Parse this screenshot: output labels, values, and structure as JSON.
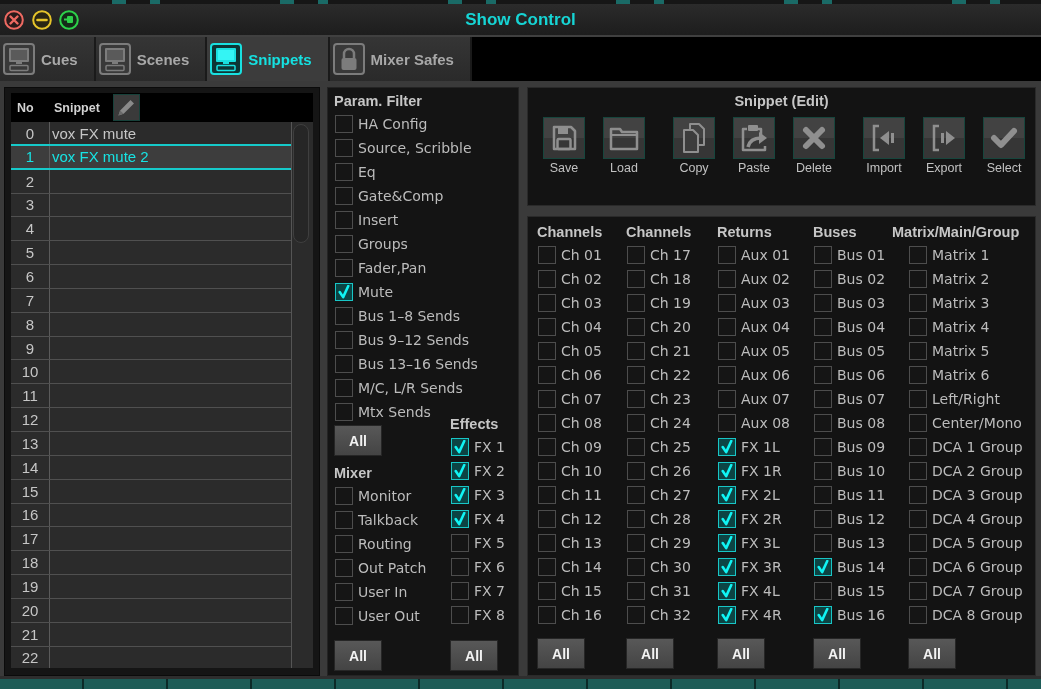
{
  "window": {
    "title": "Show Control"
  },
  "tabs": [
    {
      "label": "Cues",
      "kind": "monitor",
      "selected": false
    },
    {
      "label": "Scenes",
      "kind": "monitor",
      "selected": false
    },
    {
      "label": "Snippets",
      "kind": "monitor",
      "selected": true
    },
    {
      "label": "Mixer Safes",
      "kind": "lock",
      "selected": false
    }
  ],
  "snippet_list": {
    "columns": [
      "No",
      "Snippet"
    ],
    "rows": [
      {
        "no": "0",
        "name": "vox FX mute",
        "selected": false
      },
      {
        "no": "1",
        "name": "vox FX mute 2",
        "selected": true
      },
      {
        "no": "2",
        "selected": false
      },
      {
        "no": "3",
        "selected": false
      },
      {
        "no": "4",
        "selected": false
      },
      {
        "no": "5",
        "selected": false
      },
      {
        "no": "6",
        "selected": false
      },
      {
        "no": "7",
        "selected": false
      },
      {
        "no": "8",
        "selected": false
      },
      {
        "no": "9",
        "selected": false
      },
      {
        "no": "10",
        "selected": false
      },
      {
        "no": "11",
        "selected": false
      },
      {
        "no": "12",
        "selected": false
      },
      {
        "no": "13",
        "selected": false
      },
      {
        "no": "14",
        "selected": false
      },
      {
        "no": "15",
        "selected": false
      },
      {
        "no": "16",
        "selected": false
      },
      {
        "no": "17",
        "selected": false
      },
      {
        "no": "18",
        "selected": false
      },
      {
        "no": "19",
        "selected": false
      },
      {
        "no": "20",
        "selected": false
      },
      {
        "no": "21",
        "selected": false
      },
      {
        "no": "22",
        "selected": false
      }
    ]
  },
  "param_filter": {
    "title": "Param. Filter",
    "items": [
      {
        "label": "HA Config",
        "checked": false
      },
      {
        "label": "Source, Scribble",
        "checked": false
      },
      {
        "label": "Eq",
        "checked": false
      },
      {
        "label": "Gate&Comp",
        "checked": false
      },
      {
        "label": "Insert",
        "checked": false
      },
      {
        "label": "Groups",
        "checked": false
      },
      {
        "label": "Fader,Pan",
        "checked": false
      },
      {
        "label": "Mute",
        "checked": true
      },
      {
        "label": "Bus 1–8 Sends",
        "checked": false
      },
      {
        "label": "Bus 9–12 Sends",
        "checked": false
      },
      {
        "label": "Bus 13–16 Sends",
        "checked": false
      },
      {
        "label": "M/C, L/R Sends",
        "checked": false
      },
      {
        "label": "Mtx Sends",
        "checked": false
      }
    ],
    "all_button": "All"
  },
  "mixer": {
    "title": "Mixer",
    "items": [
      {
        "label": "Monitor",
        "checked": false
      },
      {
        "label": "Talkback",
        "checked": false
      },
      {
        "label": "Routing",
        "checked": false
      },
      {
        "label": "Out Patch",
        "checked": false
      },
      {
        "label": "User In",
        "checked": false
      },
      {
        "label": "User Out",
        "checked": false
      }
    ],
    "all_button": "All"
  },
  "effects": {
    "title": "Effects",
    "items": [
      {
        "label": "FX 1",
        "checked": true
      },
      {
        "label": "FX 2",
        "checked": true
      },
      {
        "label": "FX 3",
        "checked": true
      },
      {
        "label": "FX 4",
        "checked": true
      },
      {
        "label": "FX 5",
        "checked": false
      },
      {
        "label": "FX 6",
        "checked": false
      },
      {
        "label": "FX 7",
        "checked": false
      },
      {
        "label": "FX 8",
        "checked": false
      }
    ],
    "all_button": "All"
  },
  "snippet_edit": {
    "title": "Snippet (Edit)",
    "groups": [
      {
        "buttons": [
          {
            "label": "Save",
            "kind": "save"
          },
          {
            "label": "Load",
            "kind": "load"
          }
        ]
      },
      {
        "buttons": [
          {
            "label": "Copy",
            "kind": "copy"
          },
          {
            "label": "Paste",
            "kind": "paste"
          },
          {
            "label": "Delete",
            "kind": "delete"
          }
        ]
      },
      {
        "buttons": [
          {
            "label": "Import",
            "kind": "import"
          },
          {
            "label": "Export",
            "kind": "export"
          },
          {
            "label": "Select",
            "kind": "select"
          }
        ]
      }
    ]
  },
  "sections": [
    {
      "title": "Channels",
      "items": [
        {
          "label": "Ch 01",
          "checked": false
        },
        {
          "label": "Ch 02",
          "checked": false
        },
        {
          "label": "Ch 03",
          "checked": false
        },
        {
          "label": "Ch 04",
          "checked": false
        },
        {
          "label": "Ch 05",
          "checked": false
        },
        {
          "label": "Ch 06",
          "checked": false
        },
        {
          "label": "Ch 07",
          "checked": false
        },
        {
          "label": "Ch 08",
          "checked": false
        },
        {
          "label": "Ch 09",
          "checked": false
        },
        {
          "label": "Ch 10",
          "checked": false
        },
        {
          "label": "Ch 11",
          "checked": false
        },
        {
          "label": "Ch 12",
          "checked": false
        },
        {
          "label": "Ch 13",
          "checked": false
        },
        {
          "label": "Ch 14",
          "checked": false
        },
        {
          "label": "Ch 15",
          "checked": false
        },
        {
          "label": "Ch 16",
          "checked": false
        }
      ],
      "all_button": "All"
    },
    {
      "title": "Channels",
      "items": [
        {
          "label": "Ch 17",
          "checked": false
        },
        {
          "label": "Ch 18",
          "checked": false
        },
        {
          "label": "Ch 19",
          "checked": false
        },
        {
          "label": "Ch 20",
          "checked": false
        },
        {
          "label": "Ch 21",
          "checked": false
        },
        {
          "label": "Ch 22",
          "checked": false
        },
        {
          "label": "Ch 23",
          "checked": false
        },
        {
          "label": "Ch 24",
          "checked": false
        },
        {
          "label": "Ch 25",
          "checked": false
        },
        {
          "label": "Ch 26",
          "checked": false
        },
        {
          "label": "Ch 27",
          "checked": false
        },
        {
          "label": "Ch 28",
          "checked": false
        },
        {
          "label": "Ch 29",
          "checked": false
        },
        {
          "label": "Ch 30",
          "checked": false
        },
        {
          "label": "Ch 31",
          "checked": false
        },
        {
          "label": "Ch 32",
          "checked": false
        }
      ],
      "all_button": "All"
    },
    {
      "title": "Returns",
      "items": [
        {
          "label": "Aux 01",
          "checked": false
        },
        {
          "label": "Aux 02",
          "checked": false
        },
        {
          "label": "Aux 03",
          "checked": false
        },
        {
          "label": "Aux 04",
          "checked": false
        },
        {
          "label": "Aux 05",
          "checked": false
        },
        {
          "label": "Aux 06",
          "checked": false
        },
        {
          "label": "Aux 07",
          "checked": false
        },
        {
          "label": "Aux 08",
          "checked": false
        },
        {
          "label": "FX 1L",
          "checked": true
        },
        {
          "label": "FX 1R",
          "checked": true
        },
        {
          "label": "FX 2L",
          "checked": true
        },
        {
          "label": "FX 2R",
          "checked": true
        },
        {
          "label": "FX 3L",
          "checked": true
        },
        {
          "label": "FX 3R",
          "checked": true
        },
        {
          "label": "FX 4L",
          "checked": true
        },
        {
          "label": "FX 4R",
          "checked": true
        }
      ],
      "all_button": "All"
    },
    {
      "title": "Buses",
      "items": [
        {
          "label": "Bus 01",
          "checked": false
        },
        {
          "label": "Bus 02",
          "checked": false
        },
        {
          "label": "Bus 03",
          "checked": false
        },
        {
          "label": "Bus 04",
          "checked": false
        },
        {
          "label": "Bus 05",
          "checked": false
        },
        {
          "label": "Bus 06",
          "checked": false
        },
        {
          "label": "Bus 07",
          "checked": false
        },
        {
          "label": "Bus 08",
          "checked": false
        },
        {
          "label": "Bus 09",
          "checked": false
        },
        {
          "label": "Bus 10",
          "checked": false
        },
        {
          "label": "Bus 11",
          "checked": false
        },
        {
          "label": "Bus 12",
          "checked": false
        },
        {
          "label": "Bus 13",
          "checked": false
        },
        {
          "label": "Bus 14",
          "checked": true
        },
        {
          "label": "Bus 15",
          "checked": false
        },
        {
          "label": "Bus 16",
          "checked": true
        }
      ],
      "all_button": "All"
    },
    {
      "title": "Matrix/Main/Group",
      "items": [
        {
          "label": "Matrix 1",
          "checked": false
        },
        {
          "label": "Matrix 2",
          "checked": false
        },
        {
          "label": "Matrix 3",
          "checked": false
        },
        {
          "label": "Matrix 4",
          "checked": false
        },
        {
          "label": "Matrix 5",
          "checked": false
        },
        {
          "label": "Matrix 6",
          "checked": false
        },
        {
          "label": "Left/Right",
          "checked": false
        },
        {
          "label": "Center/Mono",
          "checked": false
        },
        {
          "label": "DCA 1 Group",
          "checked": false
        },
        {
          "label": "DCA 2 Group",
          "checked": false
        },
        {
          "label": "DCA 3 Group",
          "checked": false
        },
        {
          "label": "DCA 4 Group",
          "checked": false
        },
        {
          "label": "DCA 5 Group",
          "checked": false
        },
        {
          "label": "DCA 6 Group",
          "checked": false
        },
        {
          "label": "DCA 7 Group",
          "checked": false
        },
        {
          "label": "DCA 8 Group",
          "checked": false
        }
      ],
      "all_button": "All"
    }
  ]
}
